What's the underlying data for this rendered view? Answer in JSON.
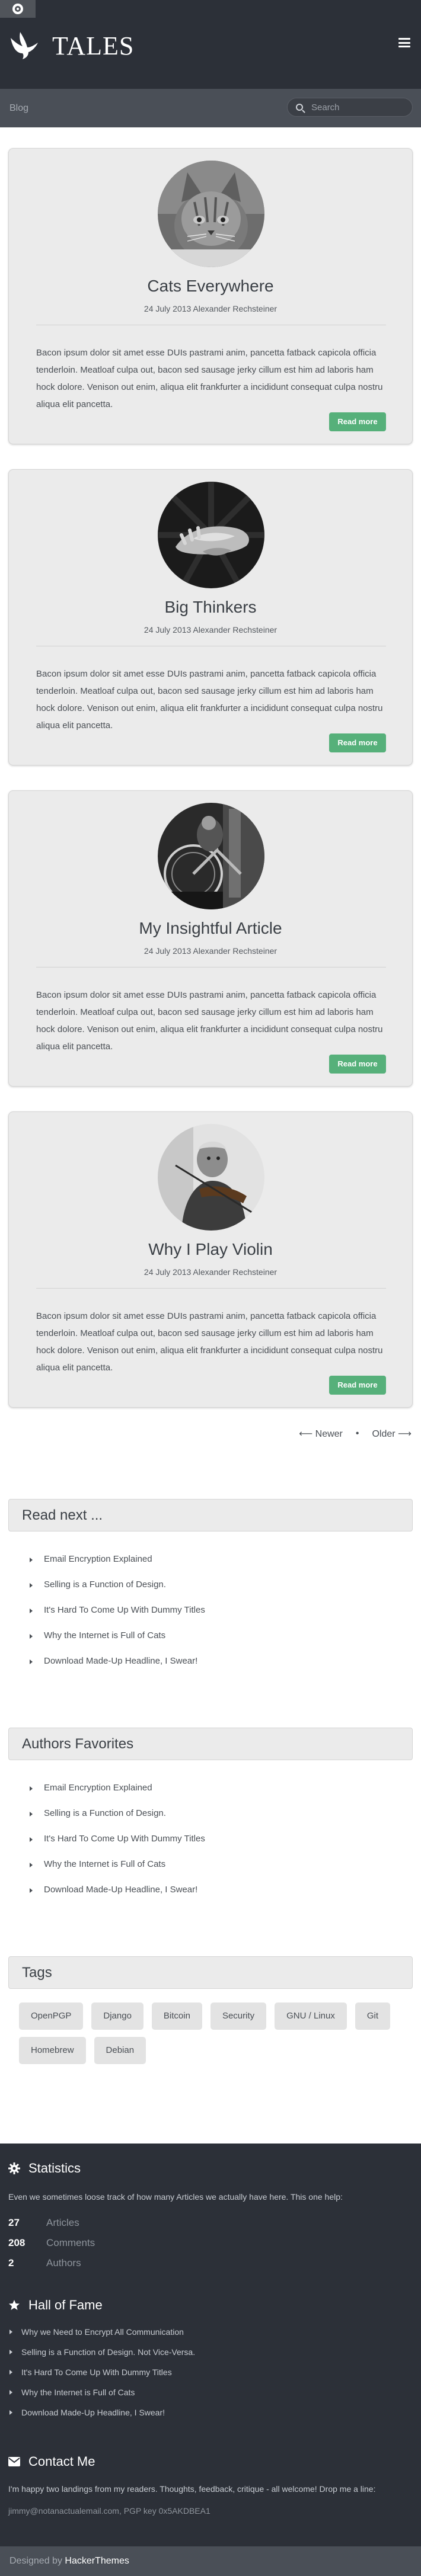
{
  "header": {
    "logo_text": "TALES",
    "logo_icon": "bird-icon",
    "menu_icon": "hamburger-icon",
    "settings_icon": "gear-icon"
  },
  "nav": {
    "breadcrumb": "Blog",
    "search_placeholder": "Search"
  },
  "articles": [
    {
      "title": "Cats Everywhere",
      "meta": "24 July 2013 Alexander Rechsteiner",
      "excerpt": "Bacon ipsum dolor sit amet esse DUIs pastrami anim, pancetta fatback capicola officia tenderloin. Meatloaf culpa out, bacon sed sausage jerky cillum est him ad laboris ham hock dolore. Venison out enim, aliqua elit frankfurter a incididunt consequat culpa nostru aliqua elit pancetta.",
      "button": "Read more",
      "image": "cat-photo"
    },
    {
      "title": "Big Thinkers",
      "meta": "24 July 2013 Alexander Rechsteiner",
      "excerpt": "Bacon ipsum dolor sit amet esse DUIs pastrami anim, pancetta fatback capicola officia tenderloin. Meatloaf culpa out, bacon sed sausage jerky cillum est him ad laboris ham hock dolore. Venison out enim, aliqua elit frankfurter a incididunt consequat culpa nostru aliqua elit pancetta.",
      "button": "Read more",
      "image": "hands-photo"
    },
    {
      "title": "My Insightful Article",
      "meta": "24 July 2013 Alexander Rechsteiner",
      "excerpt": "Bacon ipsum dolor sit amet esse DUIs pastrami anim, pancetta fatback capicola officia tenderloin. Meatloaf culpa out, bacon sed sausage jerky cillum est him ad laboris ham hock dolore. Venison out enim, aliqua elit frankfurter a incididunt consequat culpa nostru aliqua elit pancetta.",
      "button": "Read more",
      "image": "bicycle-photo"
    },
    {
      "title": "Why I Play Violin",
      "meta": "24 July 2013 Alexander Rechsteiner",
      "excerpt": "Bacon ipsum dolor sit amet esse DUIs pastrami anim, pancetta fatback capicola officia tenderloin. Meatloaf culpa out, bacon sed sausage jerky cillum est him ad laboris ham hock dolore. Venison out enim, aliqua elit frankfurter a incididunt consequat culpa nostru aliqua elit pancetta.",
      "button": "Read more",
      "image": "violin-photo"
    }
  ],
  "pagination": {
    "newer": "⟵ Newer",
    "older": "Older ⟶",
    "separator": "•"
  },
  "read_next": {
    "title": "Read next ...",
    "items": [
      "Email Encryption Explained",
      "Selling is a Function of Design.",
      "It's Hard To Come Up With Dummy Titles",
      "Why the Internet is Full of Cats",
      "Download Made-Up Headline, I Swear!"
    ]
  },
  "authors_favorites": {
    "title": "Authors Favorites",
    "items": [
      "Email Encryption Explained",
      "Selling is a Function of Design.",
      "It's Hard To Come Up With Dummy Titles",
      "Why the Internet is Full of Cats",
      "Download Made-Up Headline, I Swear!"
    ]
  },
  "tags": {
    "title": "Tags",
    "items": [
      "OpenPGP",
      "Django",
      "Bitcoin",
      "Security",
      "GNU / Linux",
      "Git",
      "Homebrew",
      "Debian"
    ]
  },
  "footer": {
    "statistics": {
      "title": "Statistics",
      "icon": "gear-icon",
      "text": "Even we sometimes loose track of how many Articles we actually have here. This one help:",
      "items": [
        {
          "num": "27",
          "label": "Articles"
        },
        {
          "num": "208",
          "label": "Comments"
        },
        {
          "num": "2",
          "label": "Authors"
        }
      ]
    },
    "hall_of_fame": {
      "title": "Hall of Fame",
      "icon": "star-icon",
      "items": [
        "Why we Need to Encrypt All Communication",
        "Selling is a Function of Design. Not Vice-Versa.",
        "It's Hard To Come Up With Dummy Titles",
        "Why the Internet is Full of Cats",
        "Download Made-Up Headline, I Swear!"
      ]
    },
    "contact": {
      "title": "Contact Me",
      "icon": "envelope-icon",
      "text": "I'm happy two landings from my readers. Thoughts, feedback, critique - all welcome! Drop me a line:",
      "email": "jimmy@notanactualemail.com, PGP key 0x5AKDBEA1"
    },
    "designed_by_prefix": "Designed by",
    "designed_by_name": "HackerThemes"
  },
  "colors": {
    "header_bg": "#2c3038",
    "navbar_bg": "#4a4f57",
    "button_green": "#56b07a",
    "card_bg": "#ebebeb"
  }
}
